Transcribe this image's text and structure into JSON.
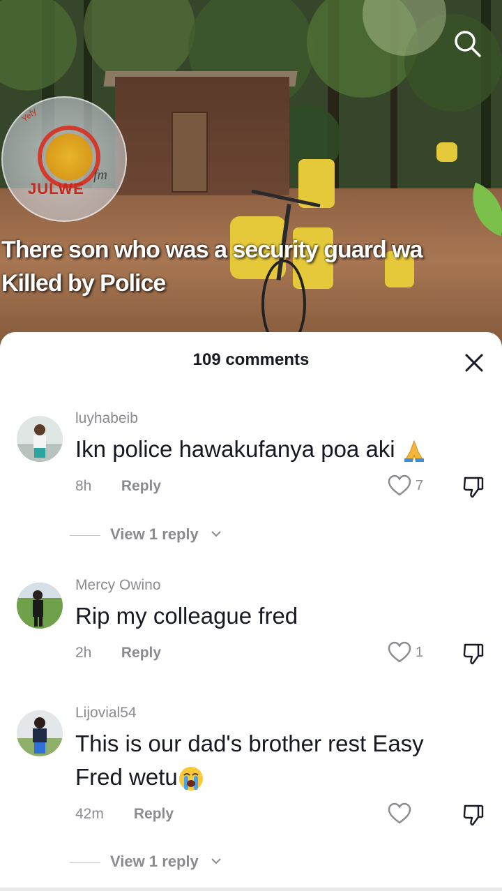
{
  "video": {
    "logo_text": "JULWE",
    "logo_fm": "fm",
    "logo_arc_text": "Yefy",
    "caption_line1": "There son who was a security guard wa",
    "caption_line2": "Killed by Police"
  },
  "sheet": {
    "title": "109 comments"
  },
  "comments": [
    {
      "username": "luyhabeib",
      "text": "Ikn police hawakufanya poa aki",
      "emoji": "praying-hands",
      "time": "8h",
      "reply_label": "Reply",
      "likes": "7",
      "view_replies": "View 1 reply"
    },
    {
      "username": "Mercy Owino",
      "text": "Rip my colleague fred",
      "time": "2h",
      "reply_label": "Reply",
      "likes": "1"
    },
    {
      "username": "Lijovial54",
      "text_line1": "This is our dad's brother rest Easy",
      "text_line2": "Fred wetu",
      "emoji": "loudly-crying-face",
      "time": "42m",
      "reply_label": "Reply",
      "likes": "",
      "view_replies": "View 1 reply"
    }
  ],
  "colors": {
    "text_primary": "#161823",
    "text_secondary": "#8a8b91",
    "sheet_bg": "#ffffff"
  }
}
